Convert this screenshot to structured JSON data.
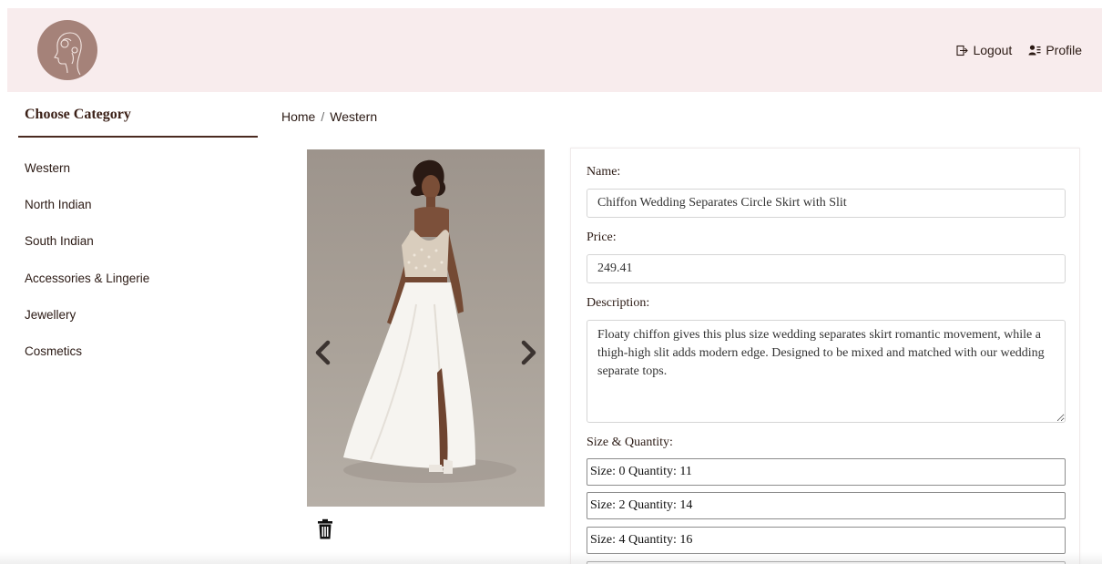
{
  "header": {
    "logo_icon": "woman-profile-logo-icon",
    "logout_label": "Logout",
    "profile_label": "Profile",
    "logout_icon": "logout-icon",
    "profile_icon": "profile-icon"
  },
  "sidebar": {
    "title": "Choose Category",
    "items": [
      {
        "label": "Western"
      },
      {
        "label": "North Indian"
      },
      {
        "label": "South Indian"
      },
      {
        "label": "Accessories & Lingerie"
      },
      {
        "label": "Jewellery"
      },
      {
        "label": "Cosmetics"
      }
    ]
  },
  "breadcrumb": {
    "home": "Home",
    "separator": "/",
    "current": "Western"
  },
  "product": {
    "image_icon": "product-photo-wedding-dress",
    "prev_icon": "chevron-left-icon",
    "next_icon": "chevron-right-icon",
    "delete_icon": "trash-icon",
    "form": {
      "name_label": "Name:",
      "name_value": "Chiffon Wedding Separates Circle Skirt with Slit",
      "price_label": "Price:",
      "price_value": "249.41",
      "description_label": "Description:",
      "description_value": "Floaty chiffon gives this plus size wedding separates skirt romantic movement, while a thigh-high slit adds modern edge. Designed to be mixed and matched with our wedding separate tops.",
      "size_quantity_label": "Size & Quantity:",
      "sizes": [
        {
          "text": "Size: 0 Quantity: 11"
        },
        {
          "text": "Size: 2 Quantity: 14"
        },
        {
          "text": "Size: 4 Quantity: 16"
        }
      ]
    }
  },
  "colors": {
    "header_bg": "#f8eced",
    "accent_brown": "#4a2a20",
    "logo_bg": "#a58279"
  }
}
